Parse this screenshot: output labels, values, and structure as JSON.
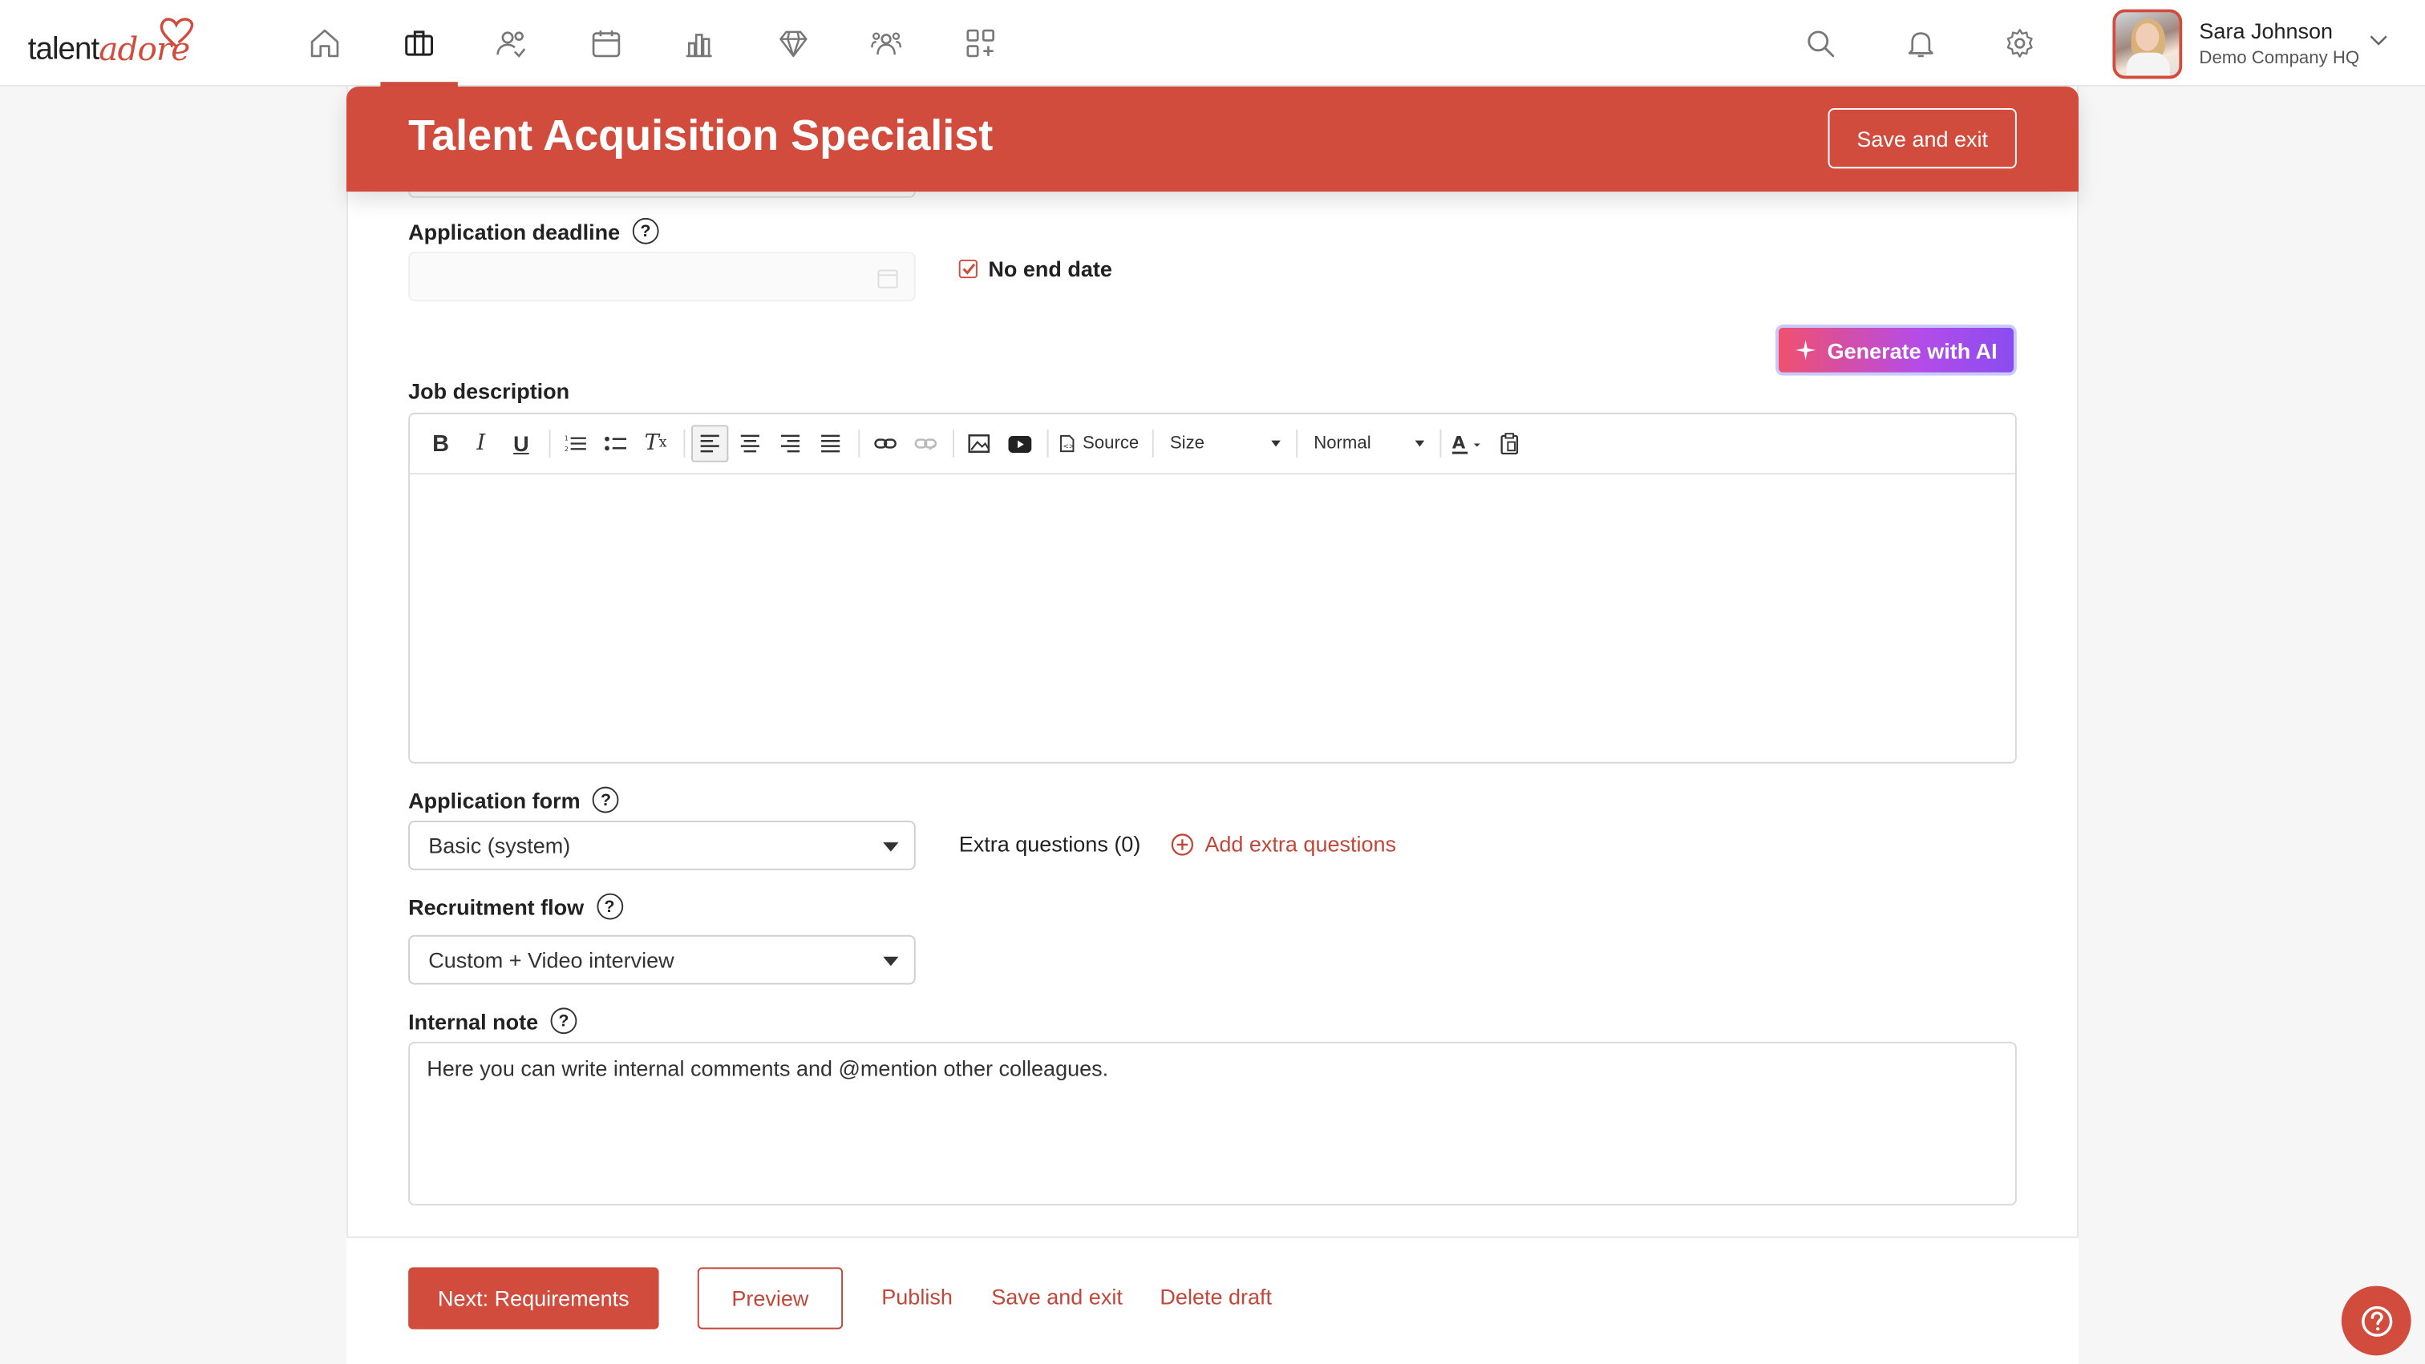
{
  "brand": {
    "logo_part1": "talent",
    "logo_part2": "adore",
    "accent": "#d24c3e"
  },
  "nav": {
    "items": [
      {
        "name": "home-icon"
      },
      {
        "name": "briefcase-icon",
        "active": true
      },
      {
        "name": "people-icon"
      },
      {
        "name": "calendar-icon"
      },
      {
        "name": "bar-chart-icon"
      },
      {
        "name": "diamond-icon"
      },
      {
        "name": "team-icon"
      },
      {
        "name": "apps-add-icon"
      }
    ]
  },
  "user": {
    "name": "Sara Johnson",
    "company": "Demo Company HQ"
  },
  "banner": {
    "title": "Talent Acquisition Specialist",
    "save_exit": "Save and exit"
  },
  "form": {
    "deadline_label": "Application deadline",
    "deadline_value": "",
    "no_end_date_label": "No end date",
    "no_end_date_checked": true,
    "generate_ai": "Generate with AI",
    "job_description_label": "Job description",
    "toolbar": {
      "source": "Source",
      "size": "Size",
      "format": "Normal"
    },
    "application_form_label": "Application form",
    "application_form_value": "Basic (system)",
    "extra_questions": "Extra questions (0)",
    "add_extra_questions": "Add extra questions",
    "recruitment_flow_label": "Recruitment flow",
    "recruitment_flow_value": "Custom + Video interview",
    "internal_note_label": "Internal note",
    "internal_note_placeholder": "Here you can write internal comments and @mention other colleagues."
  },
  "footer": {
    "next": "Next: Requirements",
    "preview": "Preview",
    "publish": "Publish",
    "save_exit": "Save and exit",
    "delete_draft": "Delete draft"
  },
  "help_icon_glyph": "?"
}
